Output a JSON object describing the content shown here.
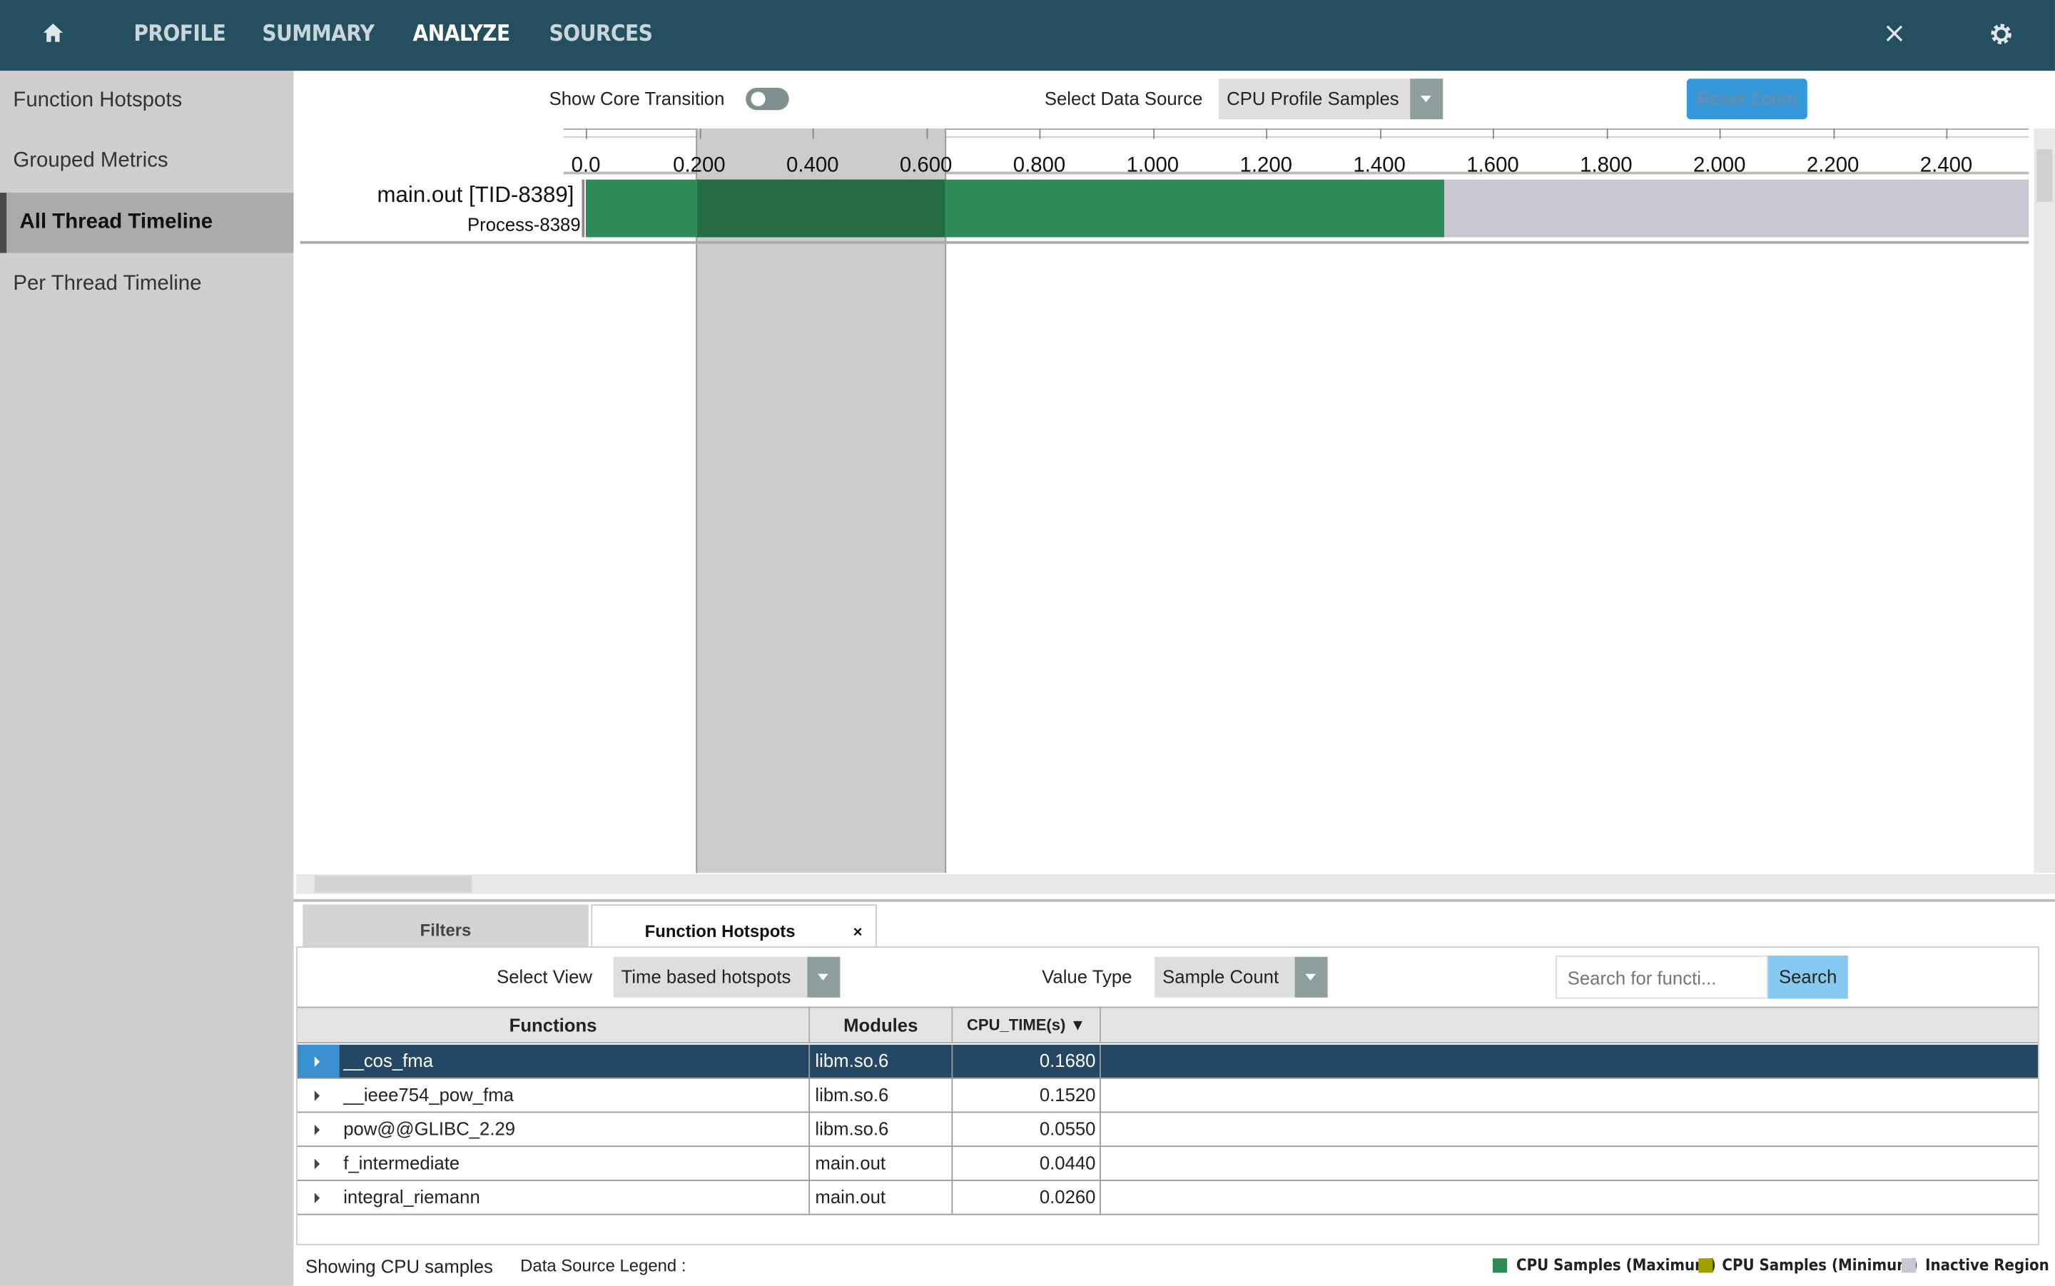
{
  "topbar": {
    "tabs": [
      {
        "label": "PROFILE"
      },
      {
        "label": "SUMMARY"
      },
      {
        "label": "ANALYZE",
        "active": true
      },
      {
        "label": "SOURCES"
      }
    ]
  },
  "sidebar": {
    "items": [
      {
        "label": "Function Hotspots"
      },
      {
        "label": "Grouped Metrics"
      },
      {
        "label": "All Thread Timeline",
        "selected": true
      },
      {
        "label": "Per Thread Timeline"
      }
    ]
  },
  "toolbar": {
    "core_transition_label": "Show Core Transition",
    "core_transition_on": false,
    "data_source_label": "Select Data Source",
    "data_source_value": "CPU Profile Samples",
    "reset_zoom": "Reset Zoom"
  },
  "timeline": {
    "ticks": [
      "0.0",
      "0.200",
      "0.400",
      "0.600",
      "0.800",
      "1.000",
      "1.200",
      "1.400",
      "1.600",
      "1.800",
      "2.000",
      "2.200",
      "2.400"
    ],
    "thread_label": "main.out [TID-8389]",
    "process_label": "Process-8389",
    "active_end": 1.515,
    "axis_end": 2.55,
    "selection": [
      0.195,
      0.635
    ]
  },
  "bottom": {
    "tabs": [
      {
        "label": "Filters"
      },
      {
        "label": "Function Hotspots",
        "active": true,
        "close": "×"
      }
    ],
    "select_view_label": "Select View",
    "select_view_value": "Time based hotspots",
    "value_type_label": "Value Type",
    "value_type_value": "Sample Count",
    "search_placeholder": "Search for functi...",
    "search_button": "Search",
    "columns": [
      "Functions",
      "Modules",
      "CPU_TIME(s) ▼"
    ],
    "rows": [
      {
        "function": "__cos_fma",
        "module": "libm.so.6",
        "cpu_time": "0.1680",
        "selected": true
      },
      {
        "function": "__ieee754_pow_fma",
        "module": "libm.so.6",
        "cpu_time": "0.1520"
      },
      {
        "function": "pow@@GLIBC_2.29",
        "module": "libm.so.6",
        "cpu_time": "0.0550"
      },
      {
        "function": "f_intermediate",
        "module": "main.out",
        "cpu_time": "0.0440"
      },
      {
        "function": "integral_riemann",
        "module": "main.out",
        "cpu_time": "0.0260"
      }
    ]
  },
  "status": {
    "showing": "Showing CPU samples",
    "legend_label": "Data Source Legend :",
    "legend": [
      {
        "label": "CPU Samples (Maximum)",
        "color": "#2e8b57"
      },
      {
        "label": "CPU Samples (Minimum)",
        "color": "#a0a000"
      },
      {
        "label": "Inactive Region",
        "color": "#c8c8d4"
      }
    ]
  },
  "colors": {
    "topbar": "#244f5f",
    "active_bar": "#2e8b57",
    "selected_bar": "#256b44",
    "inactive": "#c8c8d4",
    "selection": "#cccccc",
    "accent": "#3498db"
  }
}
